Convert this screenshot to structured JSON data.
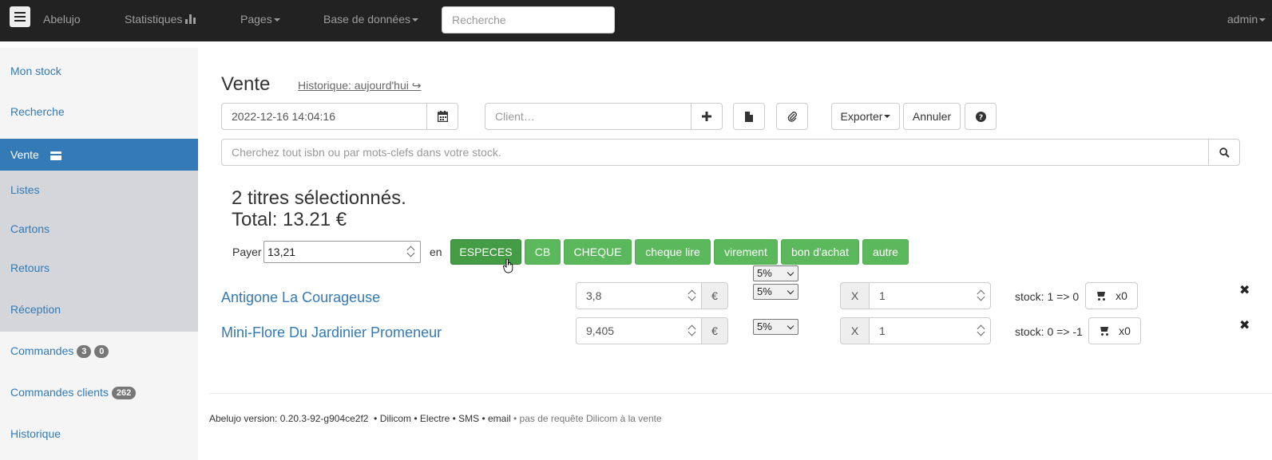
{
  "navbar": {
    "brand": "Abelujo",
    "statistics": "Statistiques",
    "pages": "Pages",
    "database": "Base de données",
    "search_placeholder": "Recherche",
    "user": "admin"
  },
  "sidebar": {
    "items": [
      {
        "label": "Mon stock"
      },
      {
        "label": "Recherche"
      },
      {
        "label": "Vente"
      },
      {
        "label": "Listes"
      },
      {
        "label": "Cartons"
      },
      {
        "label": "Retours"
      },
      {
        "label": "Réception"
      },
      {
        "label": "Commandes",
        "badges": [
          "3",
          "0"
        ]
      },
      {
        "label": "Commandes clients",
        "badges": [
          "262"
        ]
      },
      {
        "label": "Historique"
      }
    ]
  },
  "sale": {
    "title": "Vente",
    "history_link": "Historique: aujourd'hui ↪",
    "date_value": "2022-12-16 14:04:16",
    "client_placeholder": "Client…",
    "export_label": "Exporter",
    "cancel_label": "Annuler",
    "search_placeholder": "Cherchez tout isbn ou par mots-clefs dans votre stock.",
    "selected_text": "2 titres sélectionnés.",
    "total_text": "Total: 13.21 €",
    "pay_label": "Payer",
    "pay_value": "13,21",
    "in_label": "en",
    "payment_methods": [
      "ESPECES",
      "CB",
      "CHEQUE",
      "cheque lire",
      "virement",
      "bon d'achat",
      "autre"
    ],
    "global_discount": "5%",
    "currency": "€",
    "qty_prefix": "X",
    "items": [
      {
        "title": "Antigone La Courageuse",
        "price": "3,8",
        "discount": "5%",
        "qty": "1",
        "stock": "stock: 1 => 0",
        "cart": "x0"
      },
      {
        "title": "Mini-Flore Du Jardinier Promeneur",
        "price": "9,405",
        "discount": "5%",
        "qty": "1",
        "stock": "stock: 0 => -1",
        "cart": "x0"
      }
    ]
  },
  "footer": {
    "version": "Abelujo version: 0.20.3-92-g904ce2f2",
    "links": "• Dilicom • Electre • SMS • email",
    "note": "• pas de requête Dilicom à la vente"
  }
}
